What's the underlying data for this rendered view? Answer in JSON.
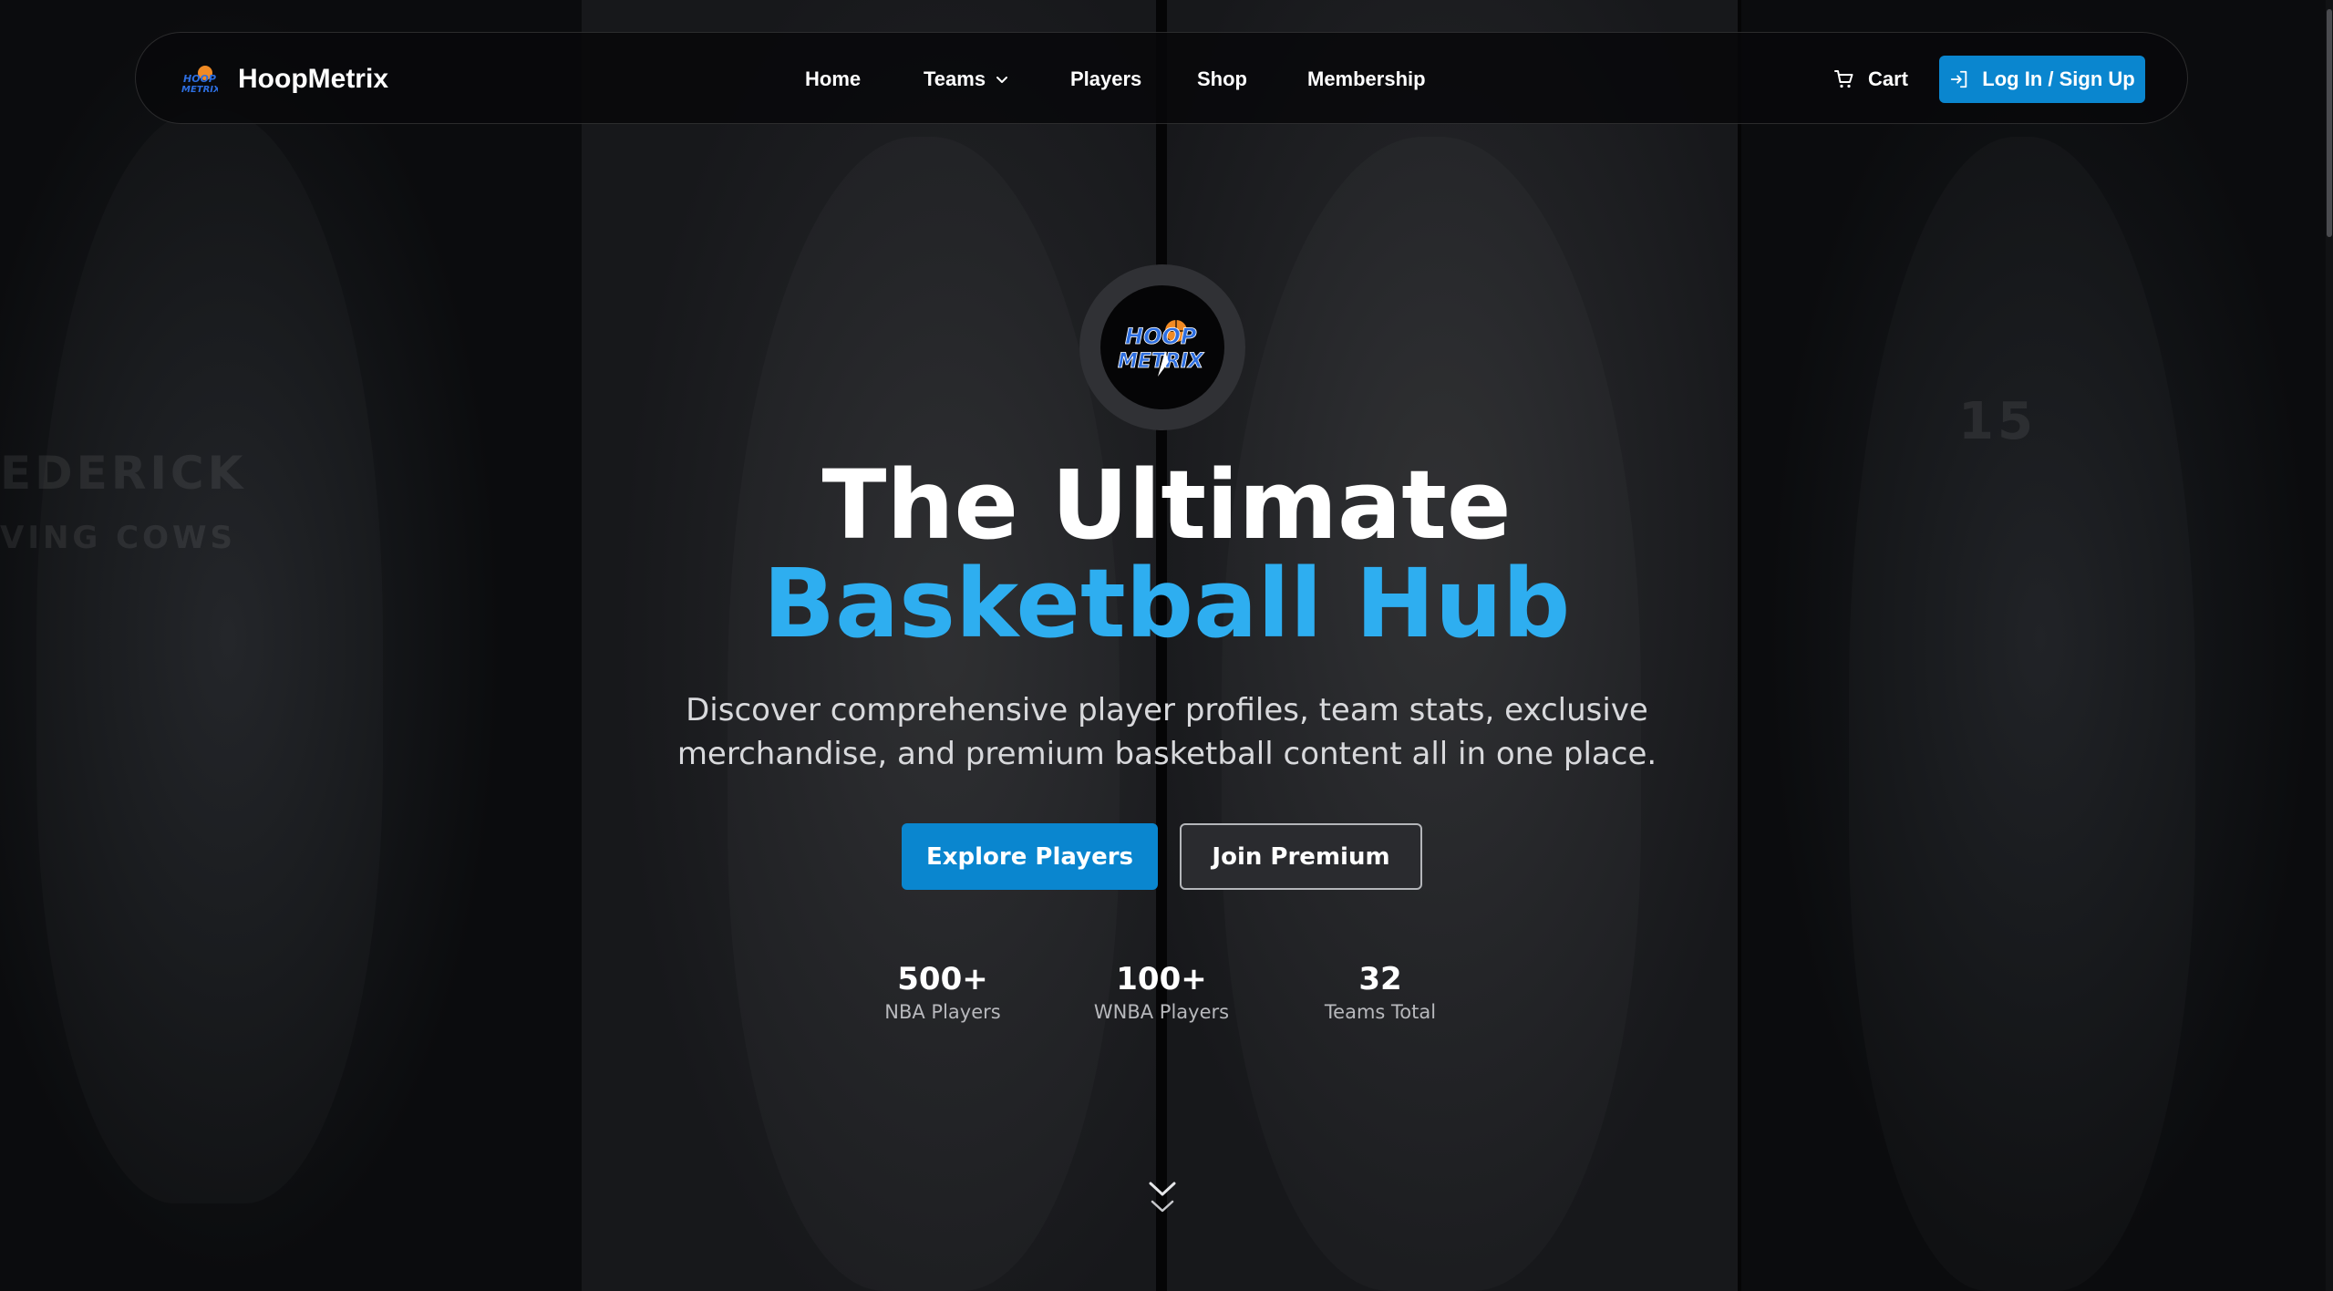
{
  "brand": {
    "name": "HoopMetrix",
    "logo_text_top": "HOOP",
    "logo_text_bottom": "METRIX"
  },
  "nav": {
    "items": [
      {
        "label": "Home"
      },
      {
        "label": "Teams"
      },
      {
        "label": "Players"
      },
      {
        "label": "Shop"
      },
      {
        "label": "Membership"
      }
    ],
    "cart_label": "Cart",
    "login_label": "Log In / Sign Up"
  },
  "hero": {
    "title_line1": "The Ultimate",
    "title_line2": "Basketball Hub",
    "subtitle": "Discover comprehensive player profiles, team stats, exclusive merchandise, and premium basketball content all in one place.",
    "primary_button": "Explore Players",
    "secondary_button": "Join Premium",
    "background_texts": [
      "EDERICK",
      "VING COWS",
      "15"
    ]
  },
  "stats": [
    {
      "value": "500+",
      "label": "NBA Players"
    },
    {
      "value": "100+",
      "label": "WNBA Players"
    },
    {
      "value": "32",
      "label": "Teams Total"
    }
  ],
  "colors": {
    "accent": "#0a86cf",
    "highlight": "#2eaef0",
    "background": "#0b0c0e"
  },
  "icons": {
    "cart": "cart-icon",
    "login": "login-icon",
    "teams_dropdown": "chevron-down-icon",
    "scroll": "double-chevron-down-icon"
  }
}
